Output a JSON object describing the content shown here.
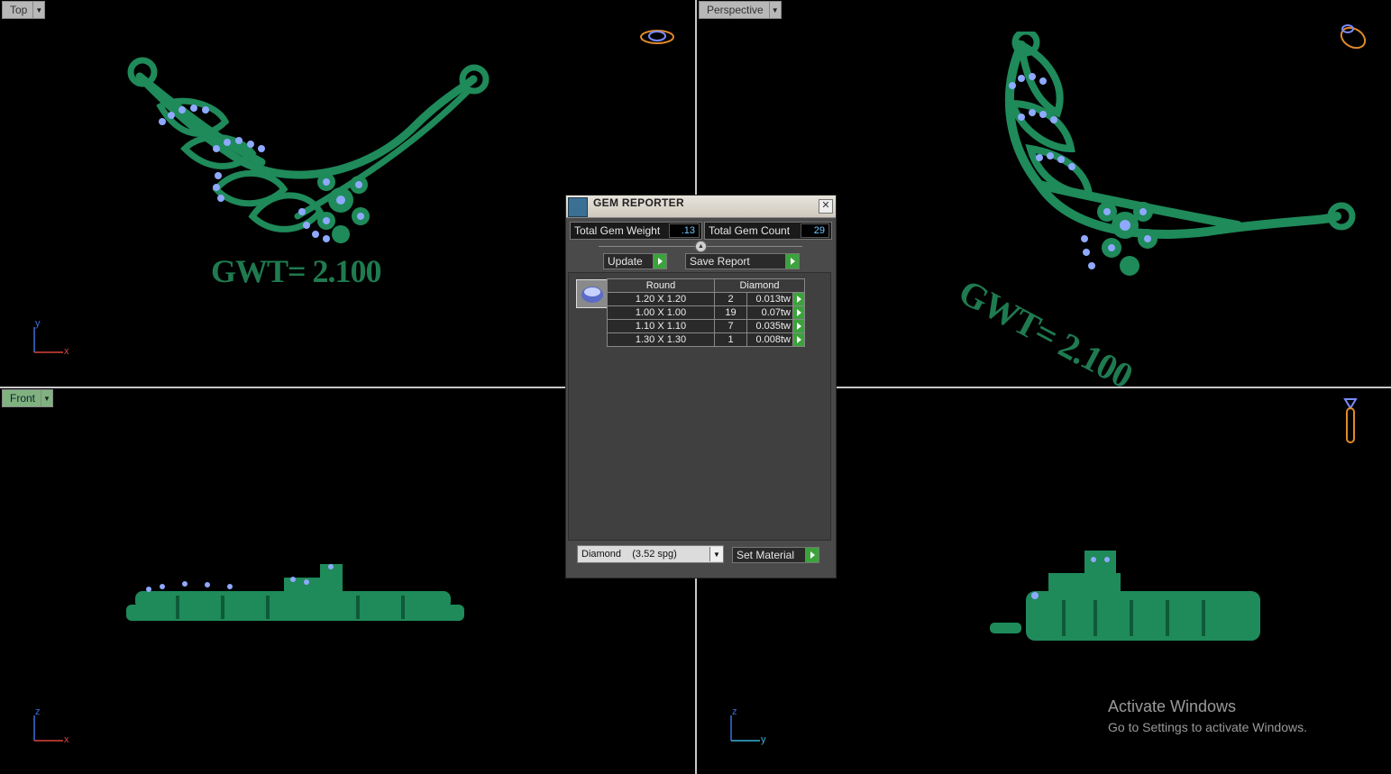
{
  "viewports": {
    "top": {
      "label": "Top"
    },
    "perspective": {
      "label": "Perspective"
    },
    "front": {
      "label": "Front"
    },
    "right": {
      "label": ""
    }
  },
  "model_text": "GWT= 2.100",
  "axes": {
    "top": {
      "v": "y",
      "h": "x"
    },
    "front": {
      "v": "z",
      "h": "x"
    },
    "right": {
      "v": "z",
      "h": "y"
    }
  },
  "gem_reporter": {
    "title": "GEM REPORTER",
    "total_weight_label": "Total Gem Weight",
    "total_weight_value": ".13",
    "total_count_label": "Total Gem Count",
    "total_count_value": "29",
    "update_label": "Update",
    "save_report_label": "Save Report",
    "table": {
      "shape_header": "Round",
      "material_header": "Diamond",
      "rows": [
        {
          "size": "1.20 X 1.20",
          "count": "2",
          "weight": "0.013tw"
        },
        {
          "size": "1.00 X 1.00",
          "count": "19",
          "weight": "0.07tw"
        },
        {
          "size": "1.10 X 1.10",
          "count": "7",
          "weight": "0.035tw"
        },
        {
          "size": "1.30 X 1.30",
          "count": "1",
          "weight": "0.008tw"
        }
      ]
    },
    "material_select": "Diamond    (3.52 spg)",
    "set_material_label": "Set Material"
  },
  "windows_watermark": {
    "line1": "Activate Windows",
    "line2": "Go to Settings to activate Windows."
  },
  "colors": {
    "metal": "#1f8a5a",
    "gem": "#8ea9ff",
    "go_button": "#3ba33b",
    "active_view": "#7fb27f"
  }
}
